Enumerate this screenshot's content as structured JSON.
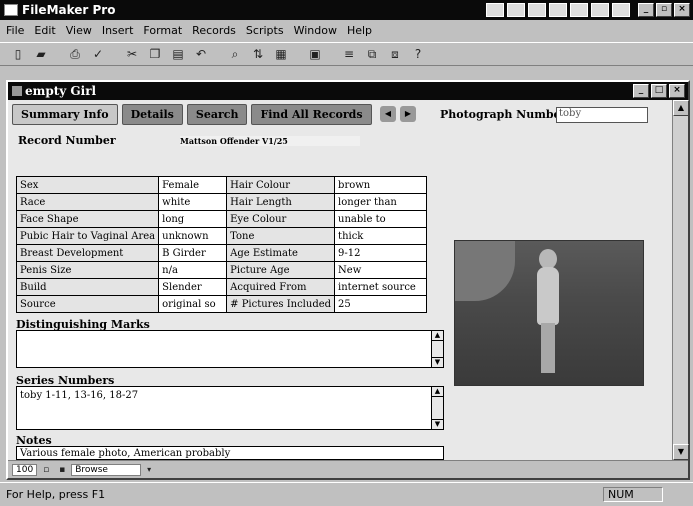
{
  "app": {
    "title": "FileMaker Pro"
  },
  "menu": [
    "File",
    "Edit",
    "View",
    "Insert",
    "Format",
    "Records",
    "Scripts",
    "Window",
    "Help"
  ],
  "toolbar": [
    "new-icon",
    "open-icon",
    "print-icon",
    "spell-icon",
    "cut-icon",
    "copy-icon",
    "paste-icon",
    "undo-icon",
    "find-icon",
    "sort-icon",
    "browse-icon",
    "layout-icon",
    "align-icon",
    "group-icon",
    "arrange-icon",
    "help-icon"
  ],
  "document": {
    "title": "empty Girl"
  },
  "tabs": [
    "Summary Info",
    "Details",
    "Search",
    "Find All Records"
  ],
  "photo_number": {
    "label": "Photograph Number",
    "value": "toby"
  },
  "record": {
    "label": "Record Number",
    "value": "Mattson Offender V1/25"
  },
  "fields": [
    {
      "l1": "Sex",
      "v1": "Female",
      "l2": "Hair Colour",
      "v2": "brown"
    },
    {
      "l1": "Race",
      "v1": "white",
      "l2": "Hair Length",
      "v2": "longer than"
    },
    {
      "l1": "Face Shape",
      "v1": "long",
      "l2": "Eye Colour",
      "v2": "unable to"
    },
    {
      "l1": "Pubic Hair to Vaginal Area",
      "v1": "unknown",
      "l2": "Tone",
      "v2": "thick"
    },
    {
      "l1": "Breast Development",
      "v1": "B Girder",
      "l2": "Age Estimate",
      "v2": "9-12"
    },
    {
      "l1": "Penis Size",
      "v1": "n/a",
      "l2": "Picture Age",
      "v2": "New"
    },
    {
      "l1": "Build",
      "v1": "Slender",
      "l2": "Acquired From",
      "v2": "internet source"
    },
    {
      "l1": "Source",
      "v1": "original so",
      "l2": "# Pictures Included",
      "v2": "25"
    }
  ],
  "distinguishing": {
    "label": "Distinguishing Marks",
    "value": ""
  },
  "series": {
    "label": "Series Numbers",
    "value": "toby 1-11, 13-16, 18-27"
  },
  "notes": {
    "label": "Notes",
    "value": "Various female photo, American probably"
  },
  "status_strip": {
    "zoom": "100",
    "mode": "Browse"
  },
  "statusbar": {
    "help": "For Help, press F1",
    "num": "NUM"
  }
}
